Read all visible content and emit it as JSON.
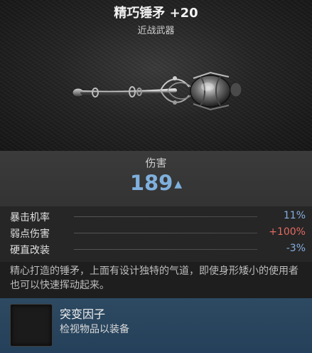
{
  "item": {
    "name": "精巧锤矛 +20",
    "type": "近战武器",
    "icon": "mace-weapon-icon"
  },
  "damage": {
    "label": "伤害",
    "value": "189",
    "trend_icon": "chevron-up-icon"
  },
  "stats": [
    {
      "label": "暴击机率",
      "value": "11%",
      "color": "#86aee0"
    },
    {
      "label": "弱点伤害",
      "value": "+100%",
      "color": "#e46a62"
    },
    {
      "label": "硬直改装",
      "value": "-3%",
      "color": "#86aee0"
    }
  ],
  "description": "精心打造的锤矛，上面有设计独特的气道，即使身形矮小的使用者也可以快速挥动起来。",
  "mutator": {
    "title": "突变因子",
    "subtitle": "检视物品以装备"
  }
}
